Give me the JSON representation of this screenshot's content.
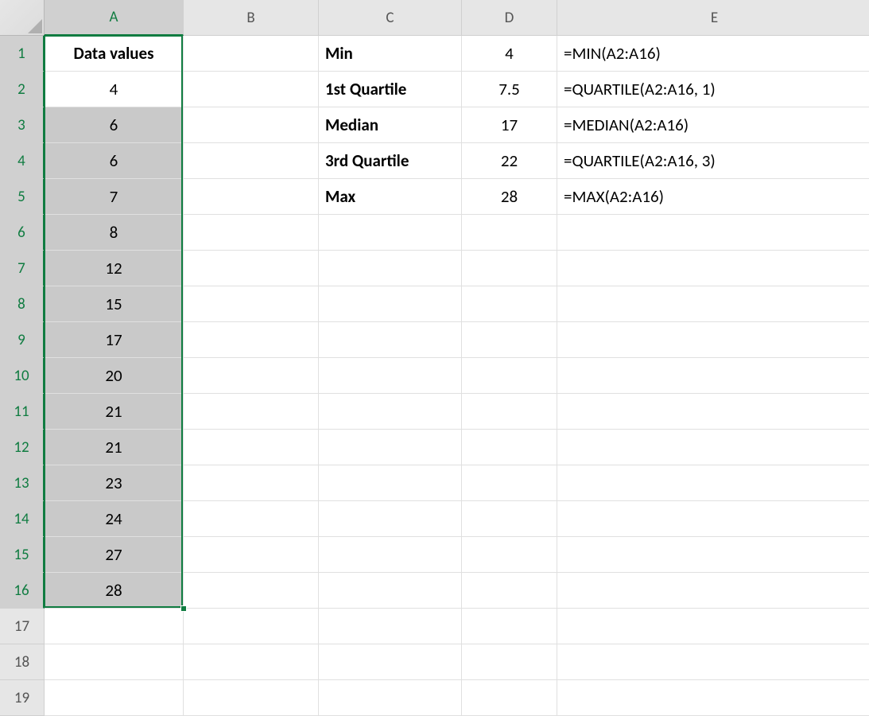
{
  "columns": [
    "A",
    "B",
    "C",
    "D",
    "E"
  ],
  "row_count": 19,
  "selected_col": "A",
  "selected_rows_start": 1,
  "selected_rows_end": 16,
  "header_label": "Data values",
  "data_values": [
    4,
    6,
    6,
    7,
    8,
    12,
    15,
    17,
    20,
    21,
    21,
    23,
    24,
    27,
    28
  ],
  "stats": [
    {
      "label": "Min",
      "value": "4",
      "formula": "=MIN(A2:A16)"
    },
    {
      "label": "1st Quartile",
      "value": "7.5",
      "formula": "=QUARTILE(A2:A16, 1)"
    },
    {
      "label": "Median",
      "value": "17",
      "formula": "=MEDIAN(A2:A16)"
    },
    {
      "label": "3rd Quartile",
      "value": "22",
      "formula": "=QUARTILE(A2:A16, 3)"
    },
    {
      "label": "Max",
      "value": "28",
      "formula": "=MAX(A2:A16)"
    }
  ]
}
